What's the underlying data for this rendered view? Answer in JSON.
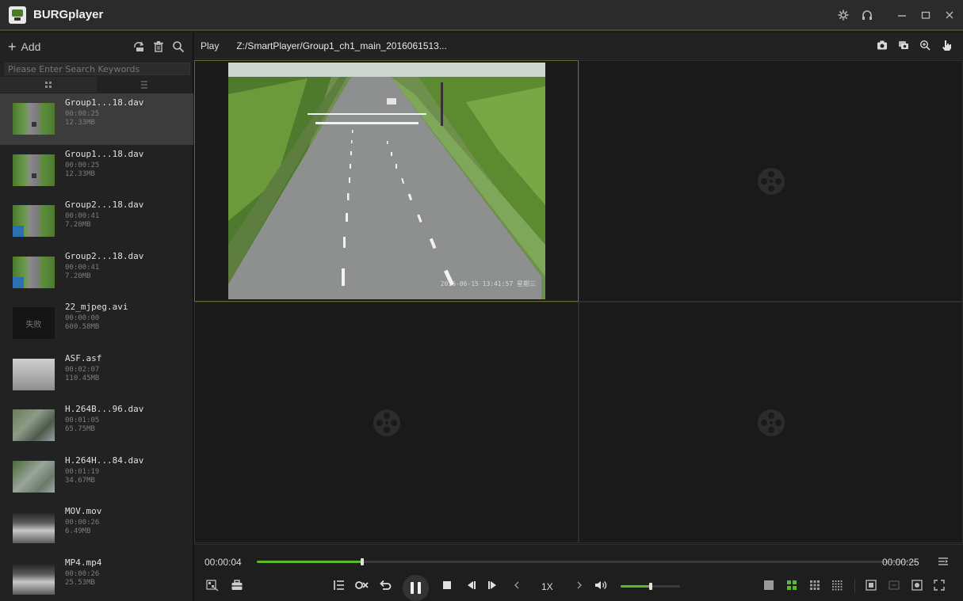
{
  "app": {
    "title": "BURGplayer"
  },
  "window_controls": [
    "settings-icon",
    "headset-icon",
    "minimize-icon",
    "maximize-icon",
    "close-icon"
  ],
  "sidebar": {
    "add_label": "Add",
    "search_placeholder": "Please Enter Search Keywords",
    "files": [
      {
        "name": "Group1...18.dav",
        "duration": "00:00:25",
        "size": "12.33MB",
        "thumb": "road",
        "selected": true
      },
      {
        "name": "Group1...18.dav",
        "duration": "00:00:25",
        "size": "12.33MB",
        "thumb": "road",
        "selected": false
      },
      {
        "name": "Group2...18.dav",
        "duration": "00:00:41",
        "size": "7.20MB",
        "thumb": "road2",
        "selected": false
      },
      {
        "name": "Group2...18.dav",
        "duration": "00:00:41",
        "size": "7.20MB",
        "thumb": "road2",
        "selected": false
      },
      {
        "name": "22_mjpeg.avi",
        "duration": "00:00:00",
        "size": "600.58MB",
        "thumb": "fail",
        "thumb_text": "失败",
        "selected": false
      },
      {
        "name": "ASF.asf",
        "duration": "00:02:07",
        "size": "110.45MB",
        "thumb": "asf",
        "selected": false
      },
      {
        "name": "H.264B...96.dav",
        "duration": "00:01:05",
        "size": "65.75MB",
        "thumb": "street",
        "selected": false
      },
      {
        "name": "H.264H...84.dav",
        "duration": "00:01:19",
        "size": "34.67MB",
        "thumb": "street2",
        "selected": false
      },
      {
        "name": "MOV.mov",
        "duration": "00:00:26",
        "size": "6.49MB",
        "thumb": "mov",
        "selected": false
      },
      {
        "name": "MP4.mp4",
        "duration": "00:00:26",
        "size": "25.53MB",
        "thumb": "mov",
        "selected": false
      }
    ]
  },
  "main": {
    "play_label": "Play",
    "file_path": "Z:/SmartPlayer/Group1_ch1_main_2016061513...",
    "video_timestamp": "2016-06-15 13:41:57 星期三"
  },
  "playback": {
    "current_time": "00:00:04",
    "total_time": "00:00:25",
    "progress": 0.16,
    "speed": "1X",
    "volume": 0.5
  },
  "colors": {
    "accent": "#5cb82e",
    "active_pane_border": "#5a6f2e"
  }
}
